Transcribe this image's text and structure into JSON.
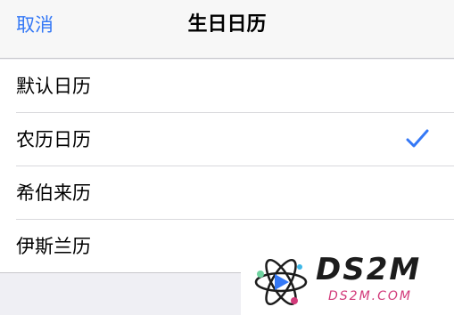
{
  "nav": {
    "cancel_label": "取消",
    "title": "生日日历"
  },
  "calendars": [
    {
      "label": "默认日历",
      "selected": false
    },
    {
      "label": "农历日历",
      "selected": true
    },
    {
      "label": "希伯来历",
      "selected": false
    },
    {
      "label": "伊斯兰历",
      "selected": false
    }
  ],
  "colors": {
    "accent": "#3478f6",
    "background": "#efeff4"
  },
  "watermark": {
    "brand": "DS2M",
    "domain": "DS2M.COM"
  }
}
